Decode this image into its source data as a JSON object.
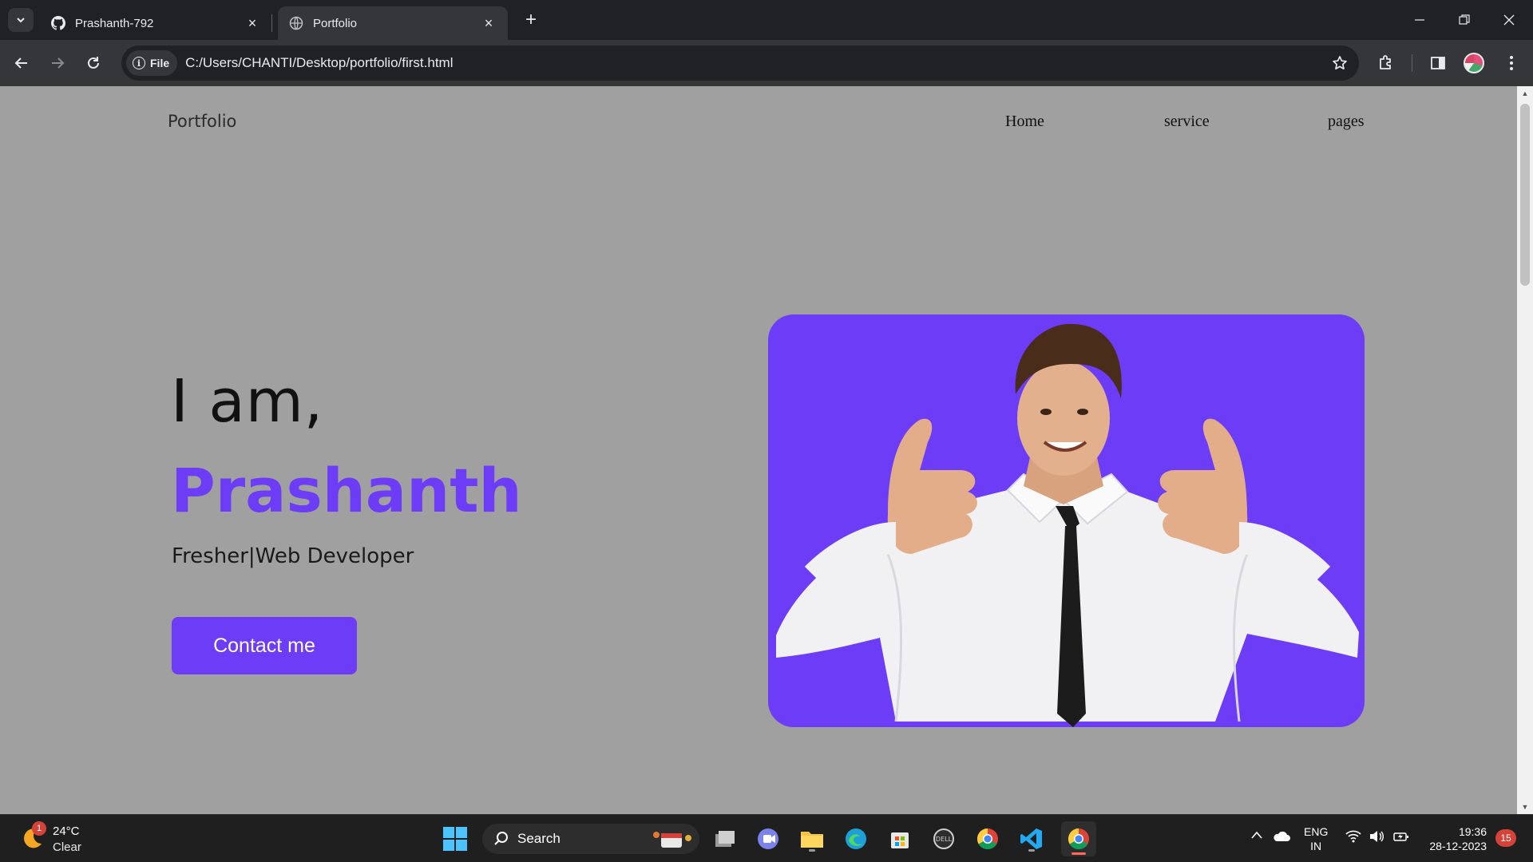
{
  "browser": {
    "tabs": [
      {
        "title": "Prashanth-792",
        "icon": "github-icon",
        "active": false
      },
      {
        "title": "Portfolio",
        "icon": "globe-icon",
        "active": true
      }
    ],
    "tab_close_glyph": "×",
    "new_tab_glyph": "+",
    "address": {
      "chip_label": "File",
      "url": "C:/Users/CHANTI/Desktop/portfolio/first.html"
    }
  },
  "page": {
    "brand": "Portfolio",
    "nav": [
      "Home",
      "service",
      "pages"
    ],
    "hero": {
      "intro": "I am,",
      "name": "Prashanth",
      "role": "Fresher|Web Developer",
      "cta": "Contact me"
    },
    "accent_color": "#6c3cf6",
    "background_color": "#a0a0a0"
  },
  "taskbar": {
    "weather": {
      "temp": "24°C",
      "condition": "Clear",
      "badge": "1"
    },
    "search_label": "Search",
    "language": {
      "line1": "ENG",
      "line2": "IN"
    },
    "clock": {
      "time": "19:36",
      "date": "28-12-2023"
    },
    "notifications": "15",
    "apps": [
      "task-view-icon",
      "teams-icon",
      "file-explorer-icon",
      "edge-icon",
      "store-icon",
      "dell-icon",
      "chrome-icon",
      "vscode-icon",
      "chrome-active-icon"
    ]
  }
}
